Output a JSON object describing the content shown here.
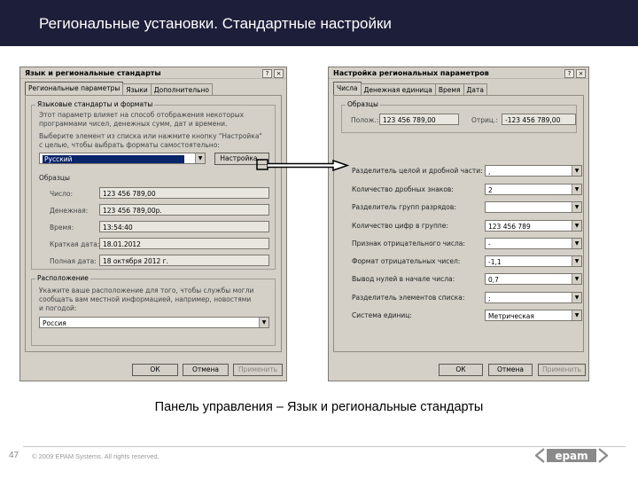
{
  "slide": {
    "title": "Региональные установки. Стандартные настройки",
    "caption": "Панель управления – Язык и региональные стандарты",
    "page_number": "47",
    "copyright": "© 2009 EPAM Systems. All rights reserved.",
    "logo_text": "epam"
  },
  "left_dialog": {
    "title": "Язык и региональные стандарты",
    "help_btn": "?",
    "close_btn": "×",
    "tabs": [
      "Региональные параметры",
      "Языки",
      "Дополнительно"
    ],
    "group1_title": "Языковые стандарты и форматы",
    "group1_text": [
      "Этот параметр влияет на способ отображения некоторых",
      "программами чисел, денежных сумм, дат и времени."
    ],
    "group1_text2": [
      "Выберите элемент из списка или нажмите кнопку \"Настройка\"",
      "с целью, чтобы выбрать форматы самостоятельно:"
    ],
    "locale_value": "Русский",
    "customize_btn": "Настройка...",
    "samples_title": "Образцы",
    "samples": [
      {
        "label": "Число:",
        "value": "123 456 789,00"
      },
      {
        "label": "Денежная:",
        "value": "123 456 789,00р."
      },
      {
        "label": "Время:",
        "value": "13:54:40"
      },
      {
        "label": "Краткая дата:",
        "value": "18.01.2012"
      },
      {
        "label": "Полная дата:",
        "value": "18 октября 2012 г."
      }
    ],
    "group2_title": "Расположение",
    "group2_text": [
      "Укажите ваше расположение для того, чтобы службы могли",
      "сообщать вам местной информацией, например, новостями",
      "и погодой:"
    ],
    "location_value": "Россия",
    "ok": "ОК",
    "cancel": "Отмена",
    "apply": "Применить"
  },
  "right_dialog": {
    "title": "Настройка региональных параметров",
    "help_btn": "?",
    "close_btn": "×",
    "tabs": [
      "Числа",
      "Денежная единица",
      "Время",
      "Дата"
    ],
    "samples_title": "Образцы",
    "pos_label": "Полож.:",
    "pos_value": "123 456 789,00",
    "neg_label": "Отриц.:",
    "neg_value": "-123 456 789,00",
    "rows": [
      {
        "label": "Разделитель целой и дробной части:",
        "value": ","
      },
      {
        "label": "Количество дробных знаков:",
        "value": "2"
      },
      {
        "label": "Разделитель групп разрядов:",
        "value": ""
      },
      {
        "label": "Количество цифр в группе:",
        "value": "123 456 789"
      },
      {
        "label": "Признак отрицательного числа:",
        "value": "-"
      },
      {
        "label": "Формат отрицательных чисел:",
        "value": "-1,1"
      },
      {
        "label": "Вывод нулей в начале числа:",
        "value": "0,7"
      },
      {
        "label": "Разделитель элементов списка:",
        "value": ";"
      },
      {
        "label": "Система единиц:",
        "value": "Метрическая"
      }
    ],
    "ok": "ОК",
    "cancel": "Отмена",
    "apply": "Применить"
  },
  "colors": {
    "title_bar": "#1d1f3a",
    "dialog_bg": "#d4d0c8",
    "selection": "#0a246a",
    "logo": "#8a8a8a"
  }
}
